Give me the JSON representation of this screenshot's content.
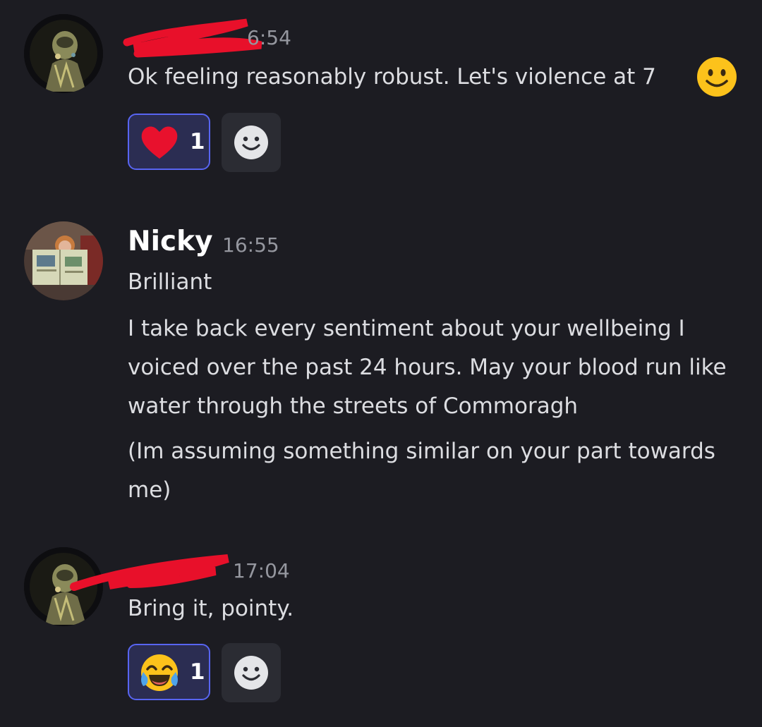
{
  "messages": [
    {
      "author": "",
      "time": "16:54",
      "time_shown": "6:54",
      "lines": [
        "Ok feeling reasonably robust. Let's violence at 7"
      ],
      "inline_emoji": "slightly-smiling-face",
      "reaction": {
        "emoji": "red-heart",
        "count": "1"
      }
    },
    {
      "author": "Nicky",
      "time": "16:55",
      "lines": [
        "Brilliant",
        "I take back every sentiment about your wellbeing I voiced over the past 24 hours. May your blood run like water through the streets of Commoragh",
        "(Im assuming something similar on your part towards me)"
      ]
    },
    {
      "author": "",
      "time": "17:04",
      "lines": [
        "Bring it, pointy."
      ],
      "reaction": {
        "emoji": "face-with-tears-of-joy",
        "count": "1"
      }
    }
  ],
  "icons": {
    "add_reaction": "smiley-face-icon"
  },
  "colors": {
    "background": "#1c1c22",
    "accent": "#5865f2",
    "reaction_bg": "#2b2d52",
    "redaction": "#e8102a"
  }
}
